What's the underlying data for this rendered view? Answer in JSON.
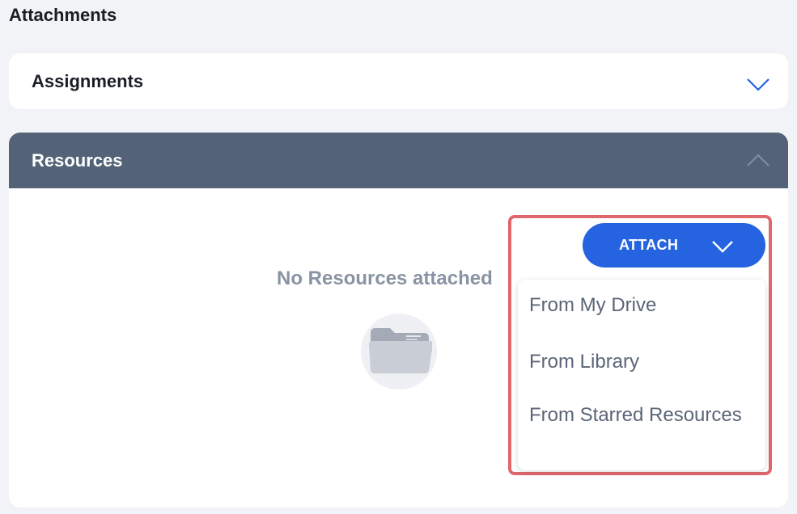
{
  "page": {
    "title": "Attachments"
  },
  "assignments": {
    "title": "Assignments",
    "expanded": false
  },
  "resources": {
    "title": "Resources",
    "expanded": true,
    "empty_text": "No Resources attached"
  },
  "attach": {
    "label": "ATTACH",
    "menu": [
      {
        "label": "From My Drive"
      },
      {
        "label": "From Library"
      },
      {
        "label": "From Starred Resources"
      }
    ]
  },
  "colors": {
    "accent": "#2563e0",
    "header": "#536277",
    "highlight": "#e0676b"
  }
}
